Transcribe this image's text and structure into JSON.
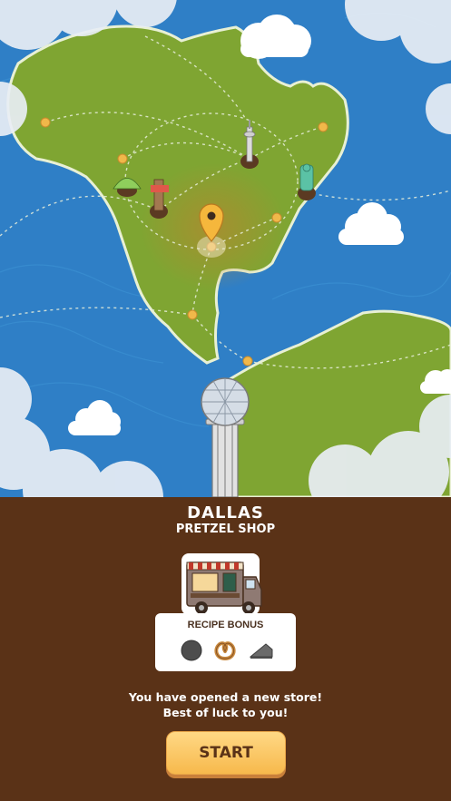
{
  "location": {
    "city": "DALLAS",
    "shop": "PRETZEL SHOP"
  },
  "recipe_bonus": {
    "label": "RECIPE BONUS",
    "items": [
      "dark-ball-icon",
      "pretzel-icon",
      "cheese-wedge-icon"
    ]
  },
  "message": {
    "line1": "You have opened a new store!",
    "line2": "Best of luck to you!"
  },
  "start_button": {
    "label": "START"
  },
  "colors": {
    "panel_bg": "#5a3217",
    "ocean": "#2f7fc6",
    "land": "#7fa532",
    "button": "#f7b94c"
  }
}
